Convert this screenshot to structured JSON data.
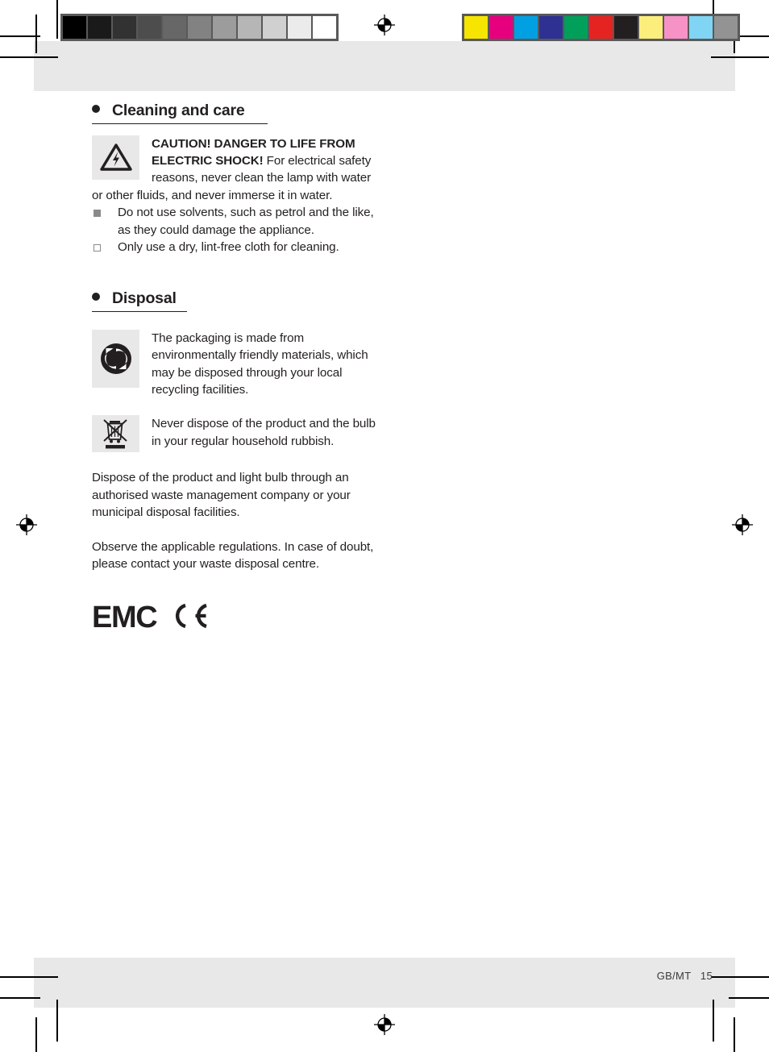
{
  "page": {
    "footer": "GB/MT   15"
  },
  "calibration": {
    "grayscale_label": "grayscale-calibration-strip",
    "grayscale_swatches": [
      "#000000",
      "#1a1a1a",
      "#323232",
      "#4d4d4d",
      "#676767",
      "#828282",
      "#9c9c9c",
      "#b6b6b6",
      "#d0d0d0",
      "#ebebeb",
      "#ffffff"
    ],
    "color_label": "color-calibration-strip",
    "color_swatches": [
      "#f6e500",
      "#e6007e",
      "#00a0e3",
      "#2e3192",
      "#00a05a",
      "#e52421",
      "#231f20",
      "#fbee7d",
      "#f692c6",
      "#80d4f4",
      "#939393"
    ]
  },
  "sections": [
    {
      "id": "cleaning",
      "heading": "Cleaning and care",
      "caution": {
        "icon": "warning-electric-shock-icon",
        "bold_lead": "CAUTION! DANGER TO LIFE FROM ELECTRIC SHOCK!",
        "body": " For electrical safety reasons, never clean the lamp with water or other fluids, and never immerse it in water."
      },
      "bullets": [
        {
          "marker": "filled",
          "text": "Do not use solvents, such as petrol and the like, as they could damage the appliance."
        },
        {
          "marker": "hollow",
          "text": "Only use a dry, lint-free cloth for cleaning."
        }
      ]
    },
    {
      "id": "disposal",
      "heading": "Disposal",
      "packaging": {
        "icon": "green-dot-recycling-icon",
        "text": "The packaging is made from environmentally friendly materials, which may be disposed through your local recycling facilities."
      },
      "weee": {
        "icon": "crossed-out-wheelie-bin-icon",
        "text": "Never dispose of the product and the bulb in your regular household rubbish."
      },
      "paragraphs": [
        "Dispose of the product and light bulb through an authorised waste management company or your municipal disposal facilities.",
        "Observe the applicable regulations. In case of doubt, please contact your waste disposal centre."
      ]
    }
  ],
  "marks": {
    "emc_label": "EMC",
    "ce_label": "CE marking"
  }
}
